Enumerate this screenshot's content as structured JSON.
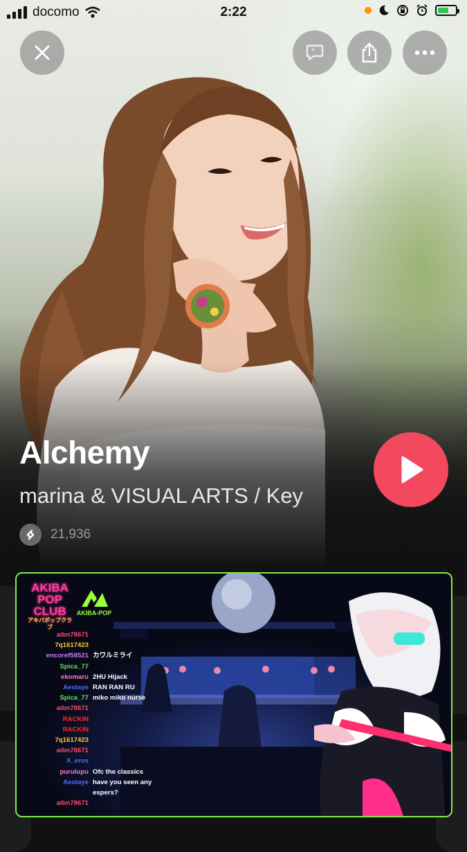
{
  "status_bar": {
    "carrier": "docomo",
    "time": "2:22",
    "battery_color": "#38c25a"
  },
  "controls": {
    "close_icon": "close-icon",
    "lyrics_icon": "lyrics-icon",
    "share_icon": "share-icon",
    "more_icon": "more-icon"
  },
  "track": {
    "title": "Alchemy",
    "artist": "marina & VISUAL ARTS / Key",
    "shazam_count": "21,936"
  },
  "colors": {
    "play_button": "#f2495f",
    "background": "#111111",
    "stream_border": "#7ef04a"
  },
  "stream": {
    "logo_line1": "AKIBA",
    "logo_line2": "POP",
    "logo_line3": "CLUB",
    "logo_sub": "アキバポップクラブ",
    "logo_right": "AKIBA-POP",
    "chat": [
      {
        "name": "aibn78671",
        "msg": "",
        "color": "#ff4d6a"
      },
      {
        "name": "7q1617423",
        "msg": "",
        "color": "#ffcc33"
      },
      {
        "name": "encoref58521",
        "msg": "カワルミライ",
        "color": "#c77dff"
      },
      {
        "name": "Spica_77",
        "msg": "",
        "color": "#5ee05e"
      },
      {
        "name": "ekomaru",
        "msg": "2HU Hijack",
        "color": "#ff7acb"
      },
      {
        "name": "Aestaye",
        "msg": "RAN RAN RU",
        "color": "#4d6bff"
      },
      {
        "name": "Spica_77",
        "msg": "miko miko nurse",
        "color": "#5ee05e"
      },
      {
        "name": "aibn78671",
        "msg": "",
        "color": "#ff4d6a"
      },
      {
        "name": "RACKIN",
        "msg": "",
        "color": "#ff2b2b"
      },
      {
        "name": "RACKIN",
        "msg": "",
        "color": "#ff2b2b"
      },
      {
        "name": "7q1617423",
        "msg": "",
        "color": "#ffcc33"
      },
      {
        "name": "aibn78671",
        "msg": "",
        "color": "#ff4d6a"
      },
      {
        "name": "X_eros",
        "msg": "",
        "color": "#4d6bff"
      },
      {
        "name": "purulupu",
        "msg": "Ofc the classics",
        "color": "#ff7acb"
      },
      {
        "name": "Aestaye",
        "msg": "have you seen any",
        "color": "#4d6bff"
      },
      {
        "name": "",
        "msg": "espers?",
        "color": "#4d6bff"
      },
      {
        "name": "aibn78671",
        "msg": "",
        "color": "#ff4d6a"
      }
    ]
  }
}
